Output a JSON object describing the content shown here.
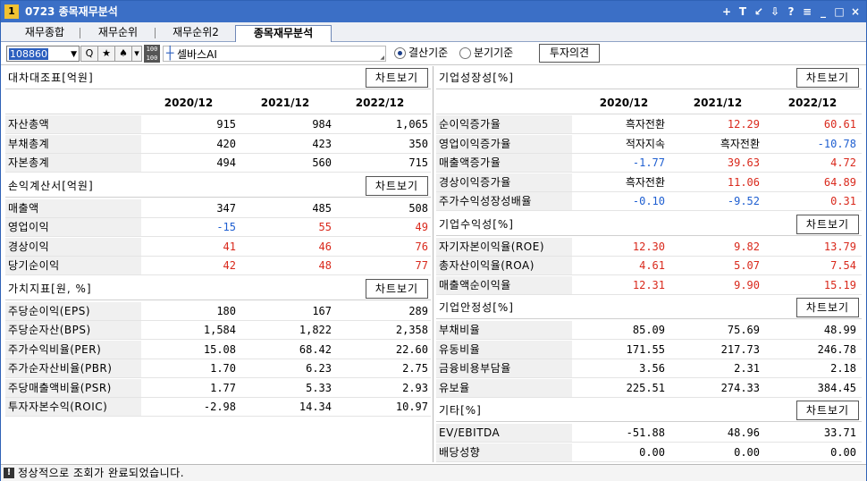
{
  "window": {
    "number": "1",
    "title": "0723 종목재무분석",
    "buttons": [
      "+",
      "T",
      "↙",
      "⇩",
      "?",
      "≡",
      "_",
      "□",
      "×"
    ]
  },
  "tabs": [
    {
      "label": "재무종합",
      "active": false
    },
    {
      "label": "재무순위",
      "active": false
    },
    {
      "label": "재무순위2",
      "active": false
    },
    {
      "label": "종목재무분석",
      "active": true
    }
  ],
  "toolbar": {
    "code": "108860",
    "search_label": "Q",
    "star_label": "★",
    "spade_label": "♠",
    "dropdown_label": "▾",
    "grid_label": "100 100",
    "stock_name": "셀바스AI",
    "radio_settlement": "결산기준",
    "radio_quarter": "분기기준",
    "settlement_selected": true,
    "invest_button": "투자의견"
  },
  "colors": {
    "positive": "#d9291c",
    "negative": "#1f5fd1",
    "title_bar": "#3b6fc6"
  },
  "chart_button_label": "차트보기",
  "left": {
    "sections": [
      {
        "title": "대차대조표[억원]",
        "header": [
          "2020/12",
          "2021/12",
          "2022/12"
        ],
        "rows": [
          {
            "label": "자산총액",
            "values": [
              "915",
              "984",
              "1,065"
            ],
            "colors": [
              "blk",
              "blk",
              "blk"
            ]
          },
          {
            "label": "부채총계",
            "values": [
              "420",
              "423",
              "350"
            ],
            "colors": [
              "blk",
              "blk",
              "blk"
            ]
          },
          {
            "label": "자본총계",
            "values": [
              "494",
              "560",
              "715"
            ],
            "colors": [
              "blk",
              "blk",
              "blk"
            ]
          }
        ]
      },
      {
        "title": "손익계산서[억원]",
        "rows": [
          {
            "label": "매출액",
            "values": [
              "347",
              "485",
              "508"
            ],
            "colors": [
              "blk",
              "blk",
              "blk"
            ]
          },
          {
            "label": "영업이익",
            "values": [
              "-15",
              "55",
              "49"
            ],
            "colors": [
              "blue",
              "red",
              "red"
            ]
          },
          {
            "label": "경상이익",
            "values": [
              "41",
              "46",
              "76"
            ],
            "colors": [
              "red",
              "red",
              "red"
            ]
          },
          {
            "label": "당기순이익",
            "values": [
              "42",
              "48",
              "77"
            ],
            "colors": [
              "red",
              "red",
              "red"
            ]
          }
        ]
      },
      {
        "title": "가치지표[원, %]",
        "rows": [
          {
            "label": "주당순이익(EPS)",
            "values": [
              "180",
              "167",
              "289"
            ],
            "colors": [
              "blk",
              "blk",
              "blk"
            ]
          },
          {
            "label": "주당순자산(BPS)",
            "values": [
              "1,584",
              "1,822",
              "2,358"
            ],
            "colors": [
              "blk",
              "blk",
              "blk"
            ]
          },
          {
            "label": "주가수익비율(PER)",
            "values": [
              "15.08",
              "68.42",
              "22.60"
            ],
            "colors": [
              "blk",
              "blk",
              "blk"
            ]
          },
          {
            "label": "주가순자산비율(PBR)",
            "values": [
              "1.70",
              "6.23",
              "2.75"
            ],
            "colors": [
              "blk",
              "blk",
              "blk"
            ]
          },
          {
            "label": "주당매출액비율(PSR)",
            "values": [
              "1.77",
              "5.33",
              "2.93"
            ],
            "colors": [
              "blk",
              "blk",
              "blk"
            ]
          },
          {
            "label": "투자자본수익(ROIC)",
            "values": [
              "-2.98",
              "14.34",
              "10.97"
            ],
            "colors": [
              "blk",
              "blk",
              "blk"
            ]
          }
        ]
      }
    ]
  },
  "right": {
    "sections": [
      {
        "title": "기업성장성[%]",
        "header": [
          "2020/12",
          "2021/12",
          "2022/12"
        ],
        "rows": [
          {
            "label": "순이익증가율",
            "values": [
              "흑자전환",
              "12.29",
              "60.61"
            ],
            "colors": [
              "blk",
              "red",
              "red"
            ]
          },
          {
            "label": "영업이익증가율",
            "values": [
              "적자지속",
              "흑자전환",
              "-10.78"
            ],
            "colors": [
              "blk",
              "blk",
              "blue"
            ]
          },
          {
            "label": "매출액증가율",
            "values": [
              "-1.77",
              "39.63",
              "4.72"
            ],
            "colors": [
              "blue",
              "red",
              "red"
            ]
          },
          {
            "label": "경상이익증가율",
            "values": [
              "흑자전환",
              "11.06",
              "64.89"
            ],
            "colors": [
              "blk",
              "red",
              "red"
            ]
          },
          {
            "label": "주가수익성장성배율",
            "values": [
              "-0.10",
              "-9.52",
              "0.31"
            ],
            "colors": [
              "blue",
              "blue",
              "red"
            ]
          }
        ]
      },
      {
        "title": "기업수익성[%]",
        "rows": [
          {
            "label": "자기자본이익율(ROE)",
            "values": [
              "12.30",
              "9.82",
              "13.79"
            ],
            "colors": [
              "red",
              "red",
              "red"
            ]
          },
          {
            "label": "총자산이익율(ROA)",
            "values": [
              "4.61",
              "5.07",
              "7.54"
            ],
            "colors": [
              "red",
              "red",
              "red"
            ]
          },
          {
            "label": "매출액순이익율",
            "values": [
              "12.31",
              "9.90",
              "15.19"
            ],
            "colors": [
              "red",
              "red",
              "red"
            ]
          }
        ]
      },
      {
        "title": "기업안정성[%]",
        "rows": [
          {
            "label": "부채비율",
            "values": [
              "85.09",
              "75.69",
              "48.99"
            ],
            "colors": [
              "blk",
              "blk",
              "blk"
            ]
          },
          {
            "label": "유동비율",
            "values": [
              "171.55",
              "217.73",
              "246.78"
            ],
            "colors": [
              "blk",
              "blk",
              "blk"
            ]
          },
          {
            "label": "금융비용부담율",
            "values": [
              "3.56",
              "2.31",
              "2.18"
            ],
            "colors": [
              "blk",
              "blk",
              "blk"
            ]
          },
          {
            "label": "유보율",
            "values": [
              "225.51",
              "274.33",
              "384.45"
            ],
            "colors": [
              "blk",
              "blk",
              "blk"
            ]
          }
        ]
      },
      {
        "title": "기타[%]",
        "rows": [
          {
            "label": "EV/EBITDA",
            "values": [
              "-51.88",
              "48.96",
              "33.71"
            ],
            "colors": [
              "blk",
              "blk",
              "blk"
            ]
          },
          {
            "label": "배당성향",
            "values": [
              "0.00",
              "0.00",
              "0.00"
            ],
            "colors": [
              "blk",
              "blk",
              "blk"
            ]
          }
        ]
      }
    ]
  },
  "status": {
    "icon": "!",
    "message": "정상적으로 조회가 완료되었습니다."
  }
}
